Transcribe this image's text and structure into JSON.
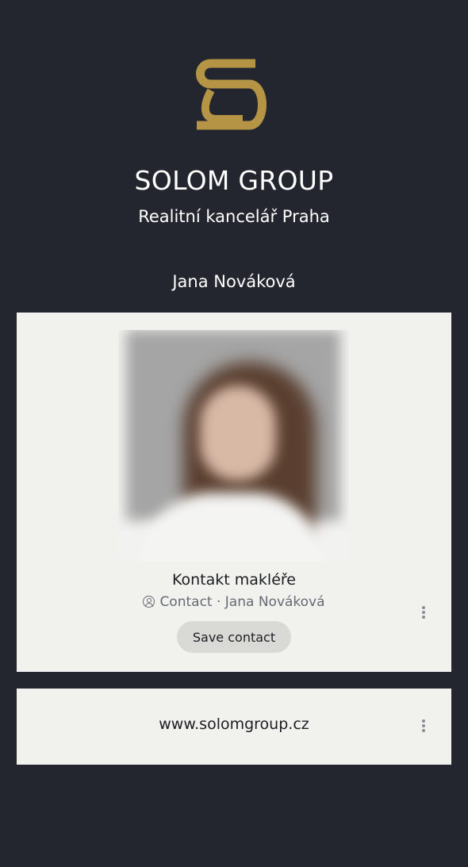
{
  "brand": {
    "name": "SOLOM GROUP",
    "subtitle": "Realitní kancelář Praha",
    "logo_icon": "sg-monogram-icon",
    "accent_color": "#b69446"
  },
  "agent": {
    "name": "Jana Nováková"
  },
  "contact_card": {
    "title": "Kontakt makléře",
    "meta_type": "Contact",
    "meta_separator": " · ",
    "meta_person": "Jana Nováková",
    "save_label": "Save contact",
    "photo_icon": "profile-photo",
    "menu_icon": "more-vert-icon"
  },
  "link_card": {
    "url_text": "www.solomgroup.cz",
    "menu_icon": "more-vert-icon"
  }
}
